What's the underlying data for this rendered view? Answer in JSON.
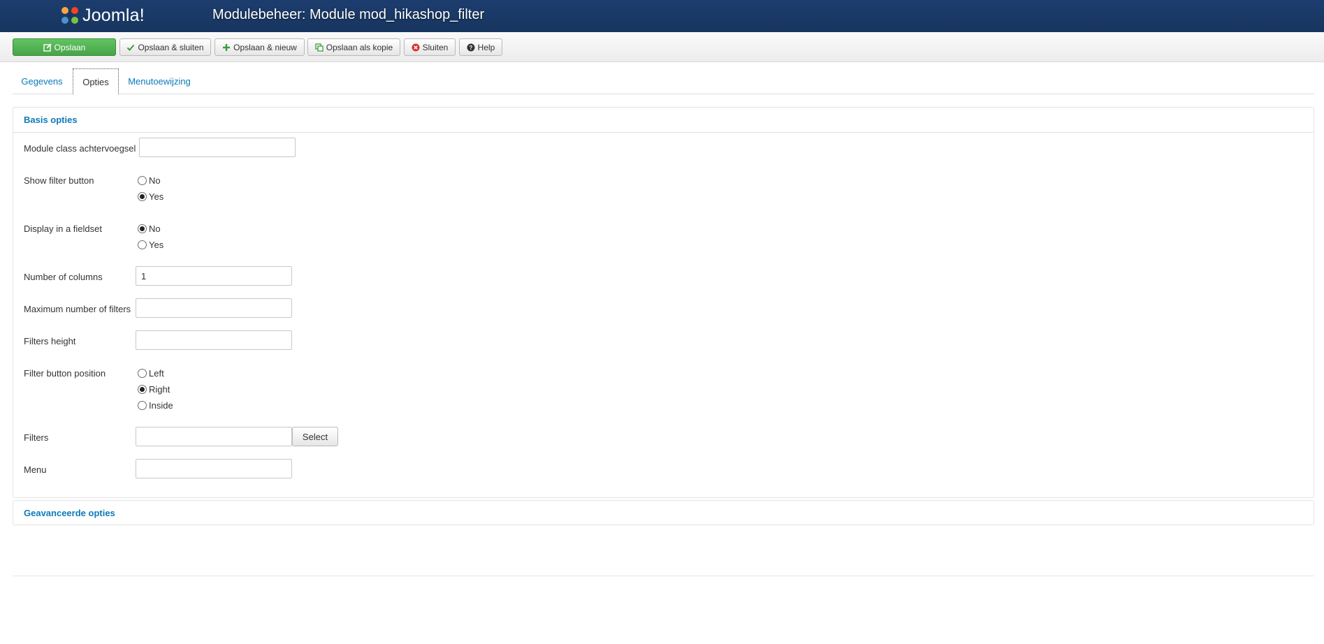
{
  "header": {
    "logo_text": "Joomla!",
    "title": "Modulebeheer: Module mod_hikashop_filter"
  },
  "toolbar": {
    "save": {
      "label": "Opslaan",
      "icon": "edit-icon"
    },
    "save_close": {
      "label": "Opslaan & sluiten",
      "icon": "check-icon"
    },
    "save_new": {
      "label": "Opslaan & nieuw",
      "icon": "plus-icon"
    },
    "save_copy": {
      "label": "Opslaan als kopie",
      "icon": "copy-icon"
    },
    "close": {
      "label": "Sluiten",
      "icon": "cancel-circle-icon"
    },
    "help": {
      "label": "Help",
      "icon": "question-icon"
    }
  },
  "tabs": [
    {
      "label": "Gegevens",
      "active": false
    },
    {
      "label": "Opties",
      "active": true
    },
    {
      "label": "Menutoewijzing",
      "active": false
    }
  ],
  "basic": {
    "title": "Basis opties",
    "module_class": {
      "label": "Module class achtervoegsel",
      "value": ""
    },
    "show_filter_button": {
      "label": "Show filter button",
      "options": [
        "No",
        "Yes"
      ],
      "selected": "Yes"
    },
    "display_fieldset": {
      "label": "Display in a fieldset",
      "options": [
        "No",
        "Yes"
      ],
      "selected": "No"
    },
    "num_columns": {
      "label": "Number of columns",
      "value": "1"
    },
    "max_filters": {
      "label": "Maximum number of filters",
      "value": ""
    },
    "filters_height": {
      "label": "Filters height",
      "value": ""
    },
    "filter_button_position": {
      "label": "Filter button position",
      "options": [
        "Left",
        "Right",
        "Inside"
      ],
      "selected": "Right"
    },
    "filters": {
      "label": "Filters",
      "value": "",
      "button": "Select"
    },
    "menu": {
      "label": "Menu",
      "value": ""
    }
  },
  "advanced": {
    "title": "Geavanceerde opties"
  },
  "colors": {
    "header_bg": "#1c3d6e",
    "link": "#0c7ab8",
    "primary_button": "#51b551"
  }
}
